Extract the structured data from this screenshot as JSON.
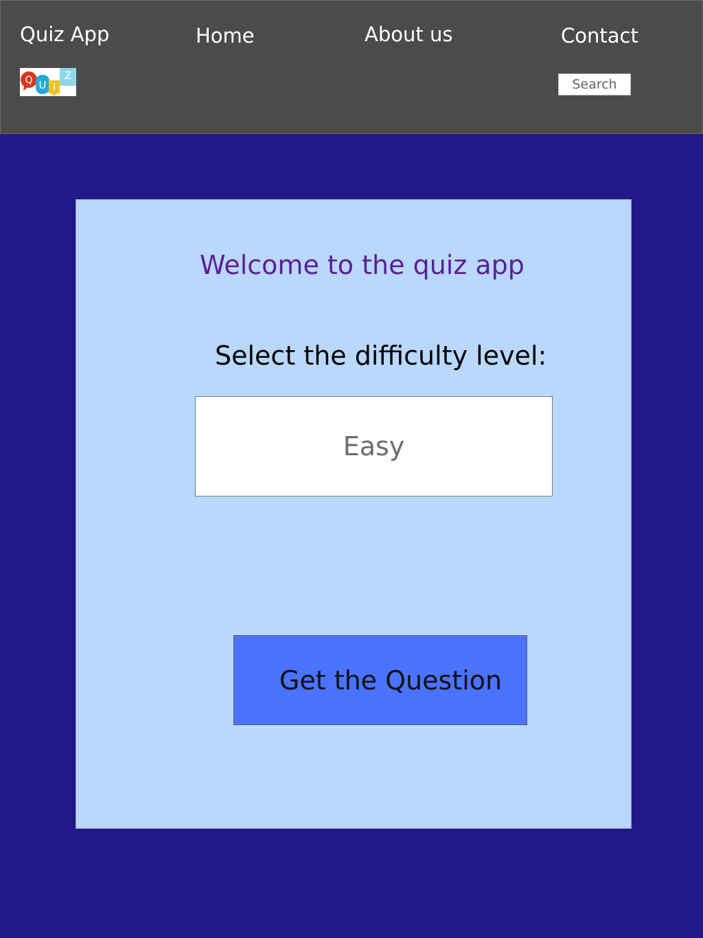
{
  "header": {
    "app_title": "Quiz App",
    "nav": {
      "home": "Home",
      "about": "About us",
      "contact": "Contact"
    },
    "logo_letters": [
      "Q",
      "U",
      "I",
      "Z"
    ],
    "search": {
      "placeholder": "Search"
    }
  },
  "main": {
    "welcome": "Welcome to the quiz app",
    "difficulty_label": "Select the difficulty level:",
    "difficulty_value": "Easy",
    "button_label": "Get the Question"
  },
  "colors": {
    "header_bg": "#4c4b4c",
    "page_bg": "#221889",
    "card_bg": "#bad8fb",
    "welcome_text": "#5a1f95",
    "button_bg": "#4a73ff"
  }
}
